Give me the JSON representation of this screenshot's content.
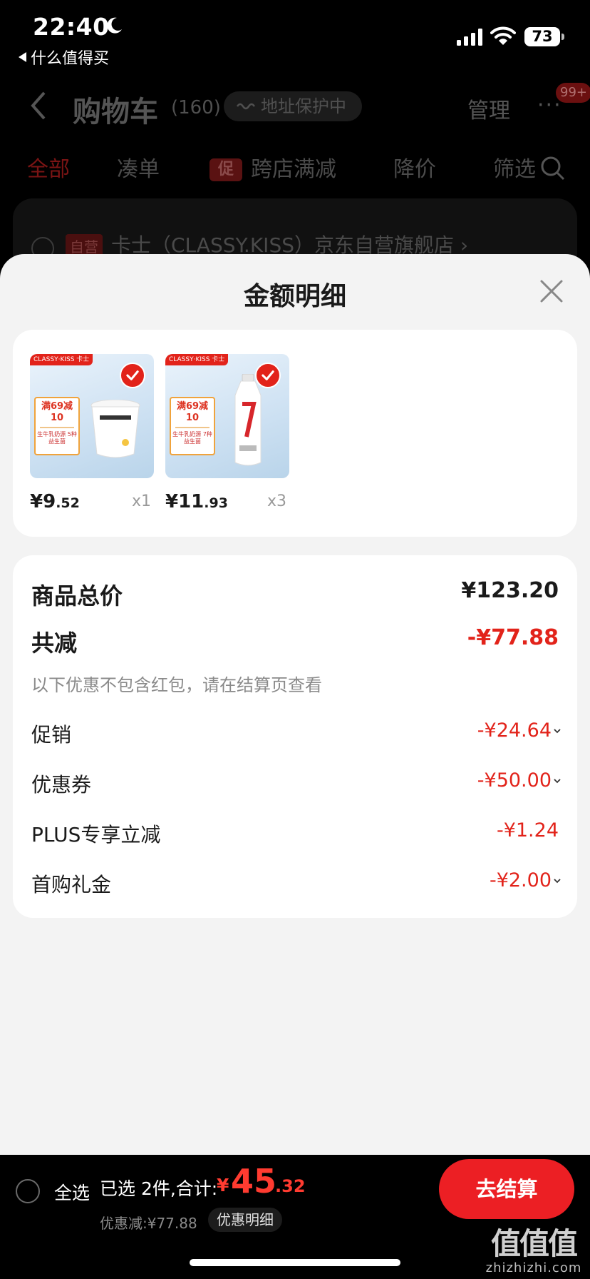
{
  "status_bar": {
    "time": "22:40",
    "back_app": "什么值得买",
    "battery": "73"
  },
  "background_page": {
    "title": "购物车",
    "count": "(160)",
    "address_protection": "地址保护中",
    "manage": "管理",
    "more": "···",
    "badge": "99+",
    "tabs": [
      "全部",
      "凑单",
      "跨店满减",
      "降价",
      "筛选"
    ],
    "promo_chip": "促",
    "shop_tag": "自营",
    "shop_name": "卡士（CLASSY.KISS）京东自营旗舰店 ›"
  },
  "sheet": {
    "title": "金额明细",
    "items": [
      {
        "brand": "CLASSY·KISS 卡士",
        "promo": "满69减10",
        "desc": "生牛乳奶源 5种益生菌",
        "price_int": "¥9",
        "price_dec": ".52",
        "qty": "x1"
      },
      {
        "brand": "CLASSY·KISS 卡士",
        "promo": "满69减10",
        "desc": "生牛乳奶源 7种益生菌",
        "price_int": "¥11",
        "price_dec": ".93",
        "qty": "x3"
      }
    ],
    "summary": {
      "total_label": "商品总价",
      "total_value": "¥123.20",
      "reduce_label": "共减",
      "reduce_value": "-¥77.88",
      "note": "以下优惠不包含红包，请在结算页查看",
      "lines": [
        {
          "label": "促销",
          "value": "-¥24.64"
        },
        {
          "label": "优惠券",
          "value": "-¥50.00"
        },
        {
          "label": "PLUS专享立减",
          "value": "-¥1.24"
        },
        {
          "label": "首购礼金",
          "value": "-¥2.00"
        }
      ]
    }
  },
  "bottom_bar": {
    "select_all": "全选",
    "selected": "已选 2件,合计:",
    "currency": "¥",
    "total_int": "45",
    "total_dec": ".32",
    "discount": "优惠减:¥77.88",
    "discount_detail": "优惠明细",
    "checkout": "去结算"
  },
  "watermark": {
    "big": "值值值",
    "small": "zhizhizhi.com"
  },
  "colors": {
    "accent_red": "#e2231a",
    "checkout_red": "#ec1f24",
    "sheet_bg": "#f3f3f3"
  }
}
